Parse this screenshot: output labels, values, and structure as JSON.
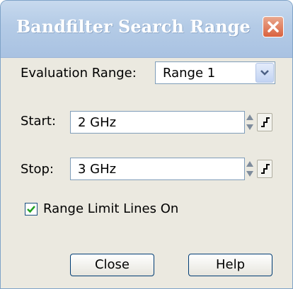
{
  "window": {
    "title": "Bandfilter Search Range",
    "close_icon": "close-x-icon"
  },
  "evaluation": {
    "label": "Evaluation Range:",
    "value": "Range 1",
    "dropdown_icon": "chevron-down-icon"
  },
  "start": {
    "label": "Start:",
    "value": "2 GHz",
    "spinner_icon": "spinner-arrows-icon",
    "step_icon": "step-icon"
  },
  "stop": {
    "label": "Stop:",
    "value": "3 GHz",
    "spinner_icon": "spinner-arrows-icon",
    "step_icon": "step-icon"
  },
  "range_limit": {
    "label": "Range Limit Lines On",
    "checked": true
  },
  "buttons": {
    "close": "Close",
    "help": "Help"
  },
  "colors": {
    "titlebar": "#b4cbe6",
    "dialog_bg": "#ebe9e0",
    "close_button": "#d9623f"
  }
}
